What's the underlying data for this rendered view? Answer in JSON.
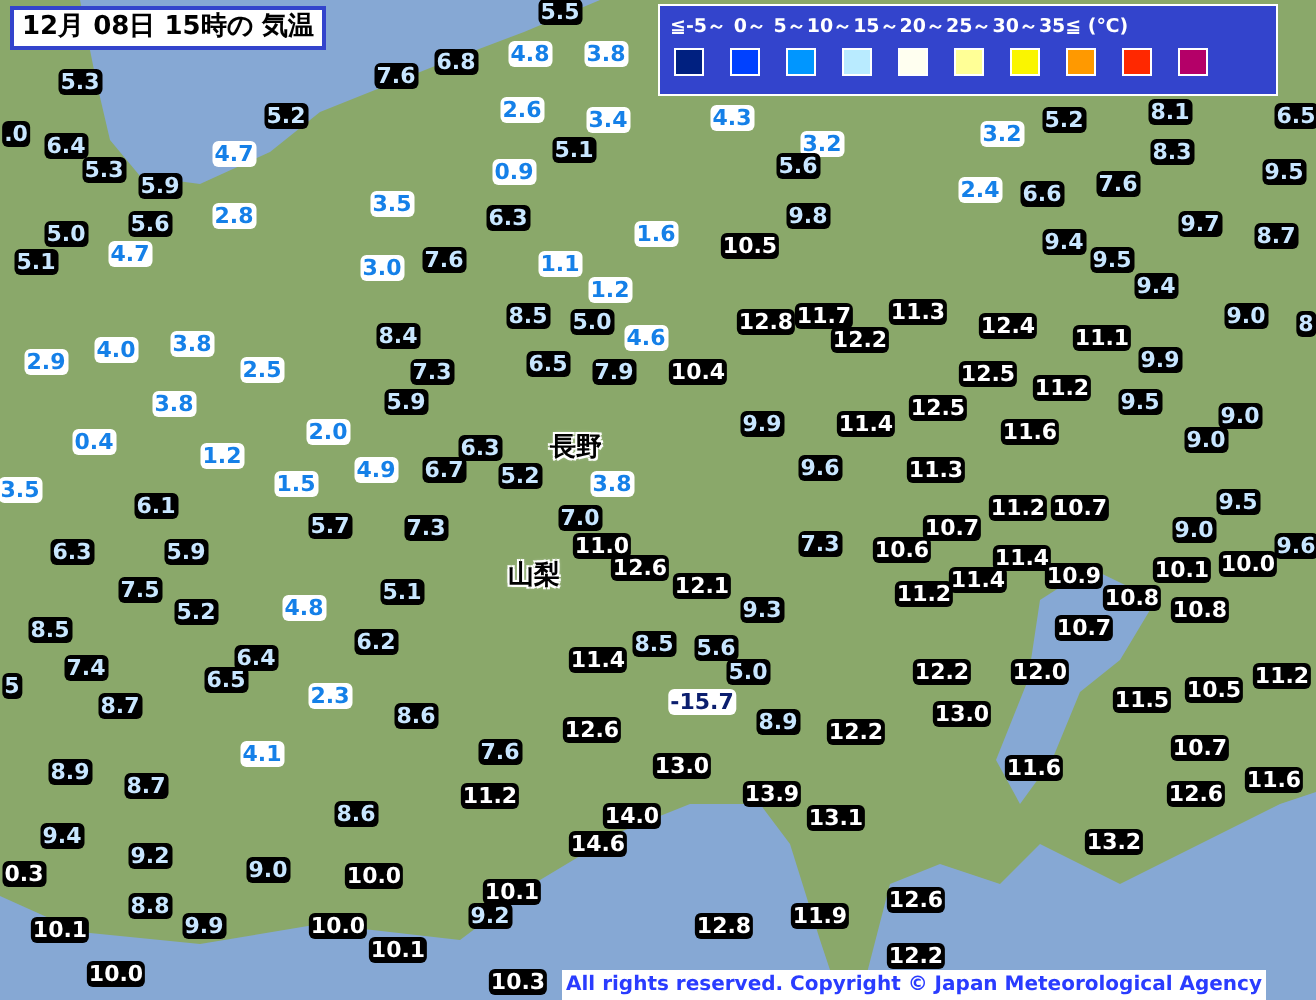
{
  "title": "12月 08日 15時の 気温",
  "legend": {
    "scale": "≦-5～ 0～ 5～10～15～20～25～30～35≦ (℃)",
    "swatches": [
      {
        "color": "#002080"
      },
      {
        "color": "#0041ff"
      },
      {
        "color": "#0096ff"
      },
      {
        "color": "#b9ebff"
      },
      {
        "color": "#fffff0"
      },
      {
        "color": "#ffff96"
      },
      {
        "color": "#faf500"
      },
      {
        "color": "#ff9900"
      },
      {
        "color": "#ff2800"
      },
      {
        "color": "#b40068"
      }
    ]
  },
  "prefectures": [
    "長野",
    "山梨"
  ],
  "stations": [
    {
      "text": "5.5",
      "kind": "mild"
    },
    {
      "text": "6.8",
      "kind": "mild"
    },
    {
      "text": "4.8",
      "kind": "cool"
    },
    {
      "text": "3.8",
      "kind": "cool"
    },
    {
      "text": "5.3",
      "kind": "mild"
    },
    {
      "text": "7.6",
      "kind": "mild"
    },
    {
      "text": "5.2",
      "kind": "mild"
    },
    {
      "text": "2.6",
      "kind": "cool"
    },
    {
      "text": "3.4",
      "kind": "cool"
    },
    {
      "text": "4.3",
      "kind": "cool"
    },
    {
      "text": "5.2",
      "kind": "mild"
    },
    {
      "text": "8.1",
      "kind": "mild"
    },
    {
      "text": "6.5",
      "kind": "mild"
    },
    {
      "text": ".0",
      "kind": "mild"
    },
    {
      "text": "3.2",
      "kind": "cool"
    },
    {
      "text": "6.4",
      "kind": "mild"
    },
    {
      "text": "4.7",
      "kind": "cool"
    },
    {
      "text": "5.1",
      "kind": "mild"
    },
    {
      "text": "3.2",
      "kind": "cool"
    },
    {
      "text": "8.3",
      "kind": "mild"
    },
    {
      "text": "5.3",
      "kind": "mild"
    },
    {
      "text": "0.9",
      "kind": "cool"
    },
    {
      "text": "5.6",
      "kind": "mild"
    },
    {
      "text": "9.5",
      "kind": "mild"
    },
    {
      "text": "5.9",
      "kind": "mild"
    },
    {
      "text": "2.4",
      "kind": "cool"
    },
    {
      "text": "6.6",
      "kind": "mild"
    },
    {
      "text": "7.6",
      "kind": "mild"
    },
    {
      "text": "3.5",
      "kind": "cool"
    },
    {
      "text": "5.6",
      "kind": "mild"
    },
    {
      "text": "2.8",
      "kind": "cool"
    },
    {
      "text": "6.3",
      "kind": "mild"
    },
    {
      "text": "9.8",
      "kind": "mild"
    },
    {
      "text": "5.0",
      "kind": "mild"
    },
    {
      "text": "1.6",
      "kind": "cool"
    },
    {
      "text": "9.7",
      "kind": "mild"
    },
    {
      "text": "9.4",
      "kind": "mild"
    },
    {
      "text": "8.7",
      "kind": "mild"
    },
    {
      "text": "4.7",
      "kind": "cool"
    },
    {
      "text": "10.5",
      "kind": "warm"
    },
    {
      "text": "5.1",
      "kind": "mild"
    },
    {
      "text": "3.0",
      "kind": "cool"
    },
    {
      "text": "7.6",
      "kind": "mild"
    },
    {
      "text": "1.1",
      "kind": "cool"
    },
    {
      "text": "9.5",
      "kind": "mild"
    },
    {
      "text": "1.2",
      "kind": "cool"
    },
    {
      "text": "9.4",
      "kind": "mild"
    },
    {
      "text": "8.5",
      "kind": "mild"
    },
    {
      "text": "5.0",
      "kind": "mild"
    },
    {
      "text": "12.8",
      "kind": "warm"
    },
    {
      "text": "11.7",
      "kind": "warm"
    },
    {
      "text": "11.3",
      "kind": "warm"
    },
    {
      "text": "12.4",
      "kind": "warm"
    },
    {
      "text": "9.0",
      "kind": "mild"
    },
    {
      "text": "8",
      "kind": "mild"
    },
    {
      "text": "4.0",
      "kind": "cool"
    },
    {
      "text": "3.8",
      "kind": "cool"
    },
    {
      "text": "8.4",
      "kind": "mild"
    },
    {
      "text": "4.6",
      "kind": "cool"
    },
    {
      "text": "12.2",
      "kind": "warm"
    },
    {
      "text": "11.1",
      "kind": "warm"
    },
    {
      "text": "2.9",
      "kind": "cool"
    },
    {
      "text": "2.5",
      "kind": "cool"
    },
    {
      "text": "7.3",
      "kind": "mild"
    },
    {
      "text": "6.5",
      "kind": "mild"
    },
    {
      "text": "7.9",
      "kind": "mild"
    },
    {
      "text": "10.4",
      "kind": "warm"
    },
    {
      "text": "12.5",
      "kind": "warm"
    },
    {
      "text": "9.9",
      "kind": "mild"
    },
    {
      "text": "11.2",
      "kind": "warm"
    },
    {
      "text": "3.8",
      "kind": "cool"
    },
    {
      "text": "5.9",
      "kind": "mild"
    },
    {
      "text": "12.5",
      "kind": "warm"
    },
    {
      "text": "9.5",
      "kind": "mild"
    },
    {
      "text": "9.9",
      "kind": "mild"
    },
    {
      "text": "11.4",
      "kind": "warm"
    },
    {
      "text": "9.0",
      "kind": "mild"
    },
    {
      "text": "0.4",
      "kind": "cool"
    },
    {
      "text": "2.0",
      "kind": "cool"
    },
    {
      "text": "6.3",
      "kind": "mild"
    },
    {
      "text": "11.6",
      "kind": "warm"
    },
    {
      "text": "9.0",
      "kind": "mild"
    },
    {
      "text": "1.2",
      "kind": "cool"
    },
    {
      "text": "4.9",
      "kind": "cool"
    },
    {
      "text": "6.7",
      "kind": "mild"
    },
    {
      "text": "5.2",
      "kind": "mild"
    },
    {
      "text": "9.6",
      "kind": "mild"
    },
    {
      "text": "11.3",
      "kind": "warm"
    },
    {
      "text": "3.5",
      "kind": "cool"
    },
    {
      "text": "1.5",
      "kind": "cool"
    },
    {
      "text": "3.8",
      "kind": "cool"
    },
    {
      "text": "6.1",
      "kind": "mild"
    },
    {
      "text": "11.2",
      "kind": "warm"
    },
    {
      "text": "10.7",
      "kind": "warm"
    },
    {
      "text": "9.5",
      "kind": "mild"
    },
    {
      "text": "5.7",
      "kind": "mild"
    },
    {
      "text": "7.3",
      "kind": "mild"
    },
    {
      "text": "7.0",
      "kind": "mild"
    },
    {
      "text": "10.7",
      "kind": "warm"
    },
    {
      "text": "9.0",
      "kind": "mild"
    },
    {
      "text": "6.3",
      "kind": "mild"
    },
    {
      "text": "5.9",
      "kind": "mild"
    },
    {
      "text": "11.0",
      "kind": "warm"
    },
    {
      "text": "7.3",
      "kind": "mild"
    },
    {
      "text": "10.6",
      "kind": "warm"
    },
    {
      "text": "11.4",
      "kind": "warm"
    },
    {
      "text": "9.6",
      "kind": "mild"
    },
    {
      "text": "12.6",
      "kind": "warm"
    },
    {
      "text": "10.1",
      "kind": "warm"
    },
    {
      "text": "10.0",
      "kind": "warm"
    },
    {
      "text": "12.1",
      "kind": "warm"
    },
    {
      "text": "11.4",
      "kind": "warm"
    },
    {
      "text": "10.9",
      "kind": "warm"
    },
    {
      "text": "7.5",
      "kind": "mild"
    },
    {
      "text": "5.1",
      "kind": "mild"
    },
    {
      "text": "11.2",
      "kind": "warm"
    },
    {
      "text": "10.8",
      "kind": "warm"
    },
    {
      "text": "5.2",
      "kind": "mild"
    },
    {
      "text": "4.8",
      "kind": "cool"
    },
    {
      "text": "9.3",
      "kind": "mild"
    },
    {
      "text": "10.8",
      "kind": "warm"
    },
    {
      "text": "8.5",
      "kind": "mild"
    },
    {
      "text": "10.7",
      "kind": "warm"
    },
    {
      "text": "6.4",
      "kind": "mild"
    },
    {
      "text": "6.2",
      "kind": "mild"
    },
    {
      "text": "11.4",
      "kind": "warm"
    },
    {
      "text": "8.5",
      "kind": "mild"
    },
    {
      "text": "5.6",
      "kind": "mild"
    },
    {
      "text": "5",
      "kind": "mild"
    },
    {
      "text": "7.4",
      "kind": "mild"
    },
    {
      "text": "6.5",
      "kind": "mild"
    },
    {
      "text": "5.0",
      "kind": "mild"
    },
    {
      "text": "12.2",
      "kind": "warm"
    },
    {
      "text": "12.0",
      "kind": "warm"
    },
    {
      "text": "11.2",
      "kind": "warm"
    },
    {
      "text": "2.3",
      "kind": "cool"
    },
    {
      "text": "10.5",
      "kind": "warm"
    },
    {
      "text": "8.7",
      "kind": "mild"
    },
    {
      "text": "-15.7",
      "kind": "cold"
    },
    {
      "text": "11.5",
      "kind": "warm"
    },
    {
      "text": "8.6",
      "kind": "mild"
    },
    {
      "text": "8.9",
      "kind": "mild"
    },
    {
      "text": "13.0",
      "kind": "warm"
    },
    {
      "text": "12.6",
      "kind": "warm"
    },
    {
      "text": "12.2",
      "kind": "warm"
    },
    {
      "text": "4.1",
      "kind": "cool"
    },
    {
      "text": "7.6",
      "kind": "mild"
    },
    {
      "text": "10.7",
      "kind": "warm"
    },
    {
      "text": "8.9",
      "kind": "mild"
    },
    {
      "text": "13.0",
      "kind": "warm"
    },
    {
      "text": "11.6",
      "kind": "warm"
    },
    {
      "text": "8.7",
      "kind": "mild"
    },
    {
      "text": "11.6",
      "kind": "warm"
    },
    {
      "text": "11.2",
      "kind": "warm"
    },
    {
      "text": "13.9",
      "kind": "warm"
    },
    {
      "text": "12.6",
      "kind": "warm"
    },
    {
      "text": "8.6",
      "kind": "mild"
    },
    {
      "text": "14.0",
      "kind": "warm"
    },
    {
      "text": "13.1",
      "kind": "warm"
    },
    {
      "text": "9.4",
      "kind": "mild"
    },
    {
      "text": "14.6",
      "kind": "warm"
    },
    {
      "text": "13.2",
      "kind": "warm"
    },
    {
      "text": "9.2",
      "kind": "mild"
    },
    {
      "text": "0.3",
      "kind": "warm"
    },
    {
      "text": "9.0",
      "kind": "mild"
    },
    {
      "text": "10.0",
      "kind": "warm"
    },
    {
      "text": "10.1",
      "kind": "warm"
    },
    {
      "text": "8.8",
      "kind": "mild"
    },
    {
      "text": "12.6",
      "kind": "warm"
    },
    {
      "text": "9.2",
      "kind": "mild"
    },
    {
      "text": "11.9",
      "kind": "warm"
    },
    {
      "text": "10.1",
      "kind": "warm"
    },
    {
      "text": "9.9",
      "kind": "mild"
    },
    {
      "text": "10.0",
      "kind": "warm"
    },
    {
      "text": "12.8",
      "kind": "warm"
    },
    {
      "text": "10.1",
      "kind": "warm"
    },
    {
      "text": "12.2",
      "kind": "warm"
    },
    {
      "text": "10.0",
      "kind": "warm"
    },
    {
      "text": "10.3",
      "kind": "warm"
    }
  ],
  "copyright": "All rights reserved. Copyright © Japan Meteorological Agency"
}
